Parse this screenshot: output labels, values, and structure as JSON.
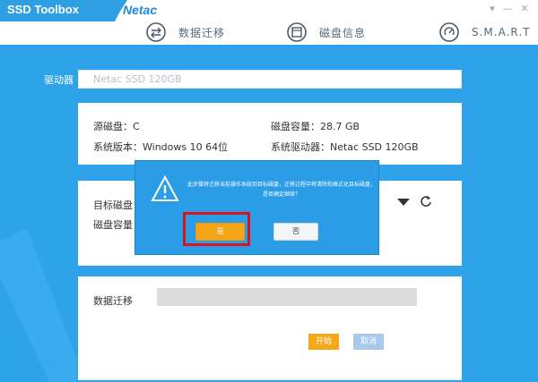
{
  "window": {
    "app_title": "SSD Toolbox",
    "brand": "Netac",
    "controls": {
      "menu": "▾",
      "minimize": "—",
      "close": "✕"
    }
  },
  "nav": {
    "tabs": [
      {
        "label": "数据迁移",
        "icon": "migrate-icon",
        "active": true
      },
      {
        "label": "磁盘信息",
        "icon": "disk-info-icon",
        "active": false
      },
      {
        "label": "S.M.A.R.T",
        "icon": "smart-icon",
        "active": false
      }
    ]
  },
  "drive": {
    "label": "驱动器",
    "value": "Netac SSD 120GB"
  },
  "source": {
    "source_disk": "源磁盘：C",
    "capacity": "磁盘容量：28.7 GB",
    "os_version": "系统版本：Windows 10 64位",
    "os_drive": "系统驱动器：Netac SSD 120GB"
  },
  "target": {
    "target_disk_label": "目标磁盘",
    "capacity_label": "磁盘容量"
  },
  "migration": {
    "label": "数据迁移",
    "progress": 0,
    "start_label": "开始",
    "cancel_label": "取消"
  },
  "dialog": {
    "message": "此步骤将迁移当前操作系统到目标磁盘，迁移过程中将清除和格式化目标磁盘，是否确定继续？",
    "yes_label": "是",
    "no_label": "否"
  },
  "colors": {
    "background": "#2fa3ea",
    "accent": "#f6a516",
    "highlight": "#d6141b"
  }
}
